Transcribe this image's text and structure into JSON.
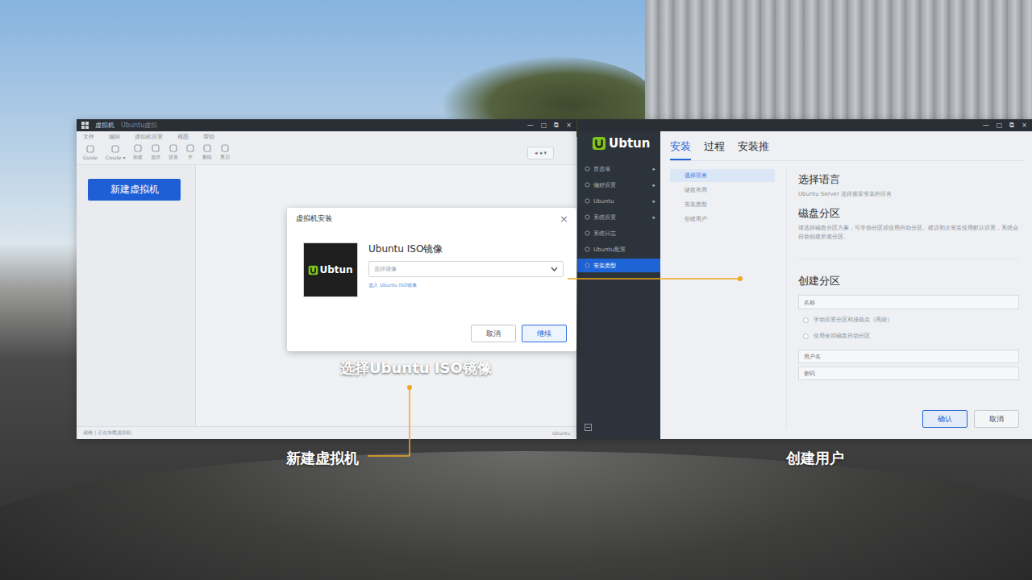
{
  "callouts": [
    {
      "text": "选择Ubuntu ISO镜像"
    },
    {
      "text": "新建虚拟机"
    },
    {
      "text": "创建用户"
    }
  ],
  "vm_window": {
    "title": "虚拟机",
    "subtitle": "Ubuntu虚拟",
    "controls": [
      "—",
      "▢",
      "⧉",
      "×"
    ],
    "menu": [
      "文件",
      "编辑",
      "虚拟机设置",
      "视图",
      "帮助"
    ],
    "toolbar": [
      "Guide",
      "Create ▾",
      "新建",
      "选择",
      "设置",
      "开",
      "删除",
      "重启"
    ],
    "view_select": "◂ ◂ ▾",
    "new_vm_button": "新建虚拟机",
    "status_left": "就绪 | 正在加载虚拟机",
    "status_right": "Ubuntu"
  },
  "dialog": {
    "title": "虚拟机安装",
    "close": "×",
    "logo": "Ubtun",
    "label": "Ubuntu ISO镜像",
    "select_placeholder": "选择镜像",
    "hint": "选入 Ubuntu ISO镜像",
    "buttons": [
      {
        "label": "取消",
        "primary": false
      },
      {
        "label": "继续",
        "primary": true
      }
    ]
  },
  "installer": {
    "logo": "Ubtun",
    "controls": [
      "—",
      "▢",
      "⧉",
      "×"
    ],
    "sidebar": [
      {
        "label": "首选项",
        "arrow": "▸",
        "selected": false
      },
      {
        "label": "偏好设置",
        "arrow": "▸",
        "selected": false
      },
      {
        "label": "Ubuntu",
        "arrow": "▸",
        "selected": false
      },
      {
        "label": "系统设置",
        "arrow": "▸",
        "selected": false
      },
      {
        "label": "系统日志",
        "arrow": "",
        "selected": false
      },
      {
        "label": "Ubuntu配置",
        "arrow": "",
        "selected": false
      },
      {
        "label": "安装类型",
        "arrow": "",
        "selected": true
      }
    ],
    "tabs": [
      {
        "label": "安装",
        "selected": true
      },
      {
        "label": "过程",
        "selected": false
      },
      {
        "label": "安装推",
        "selected": false
      }
    ],
    "steps": [
      {
        "label": "选择语言",
        "selected": true
      },
      {
        "label": "键盘布局",
        "selected": false
      },
      {
        "label": "安装类型",
        "selected": false
      },
      {
        "label": "创建用户",
        "selected": false
      }
    ],
    "language_title": "选择语言",
    "language_text": "Ubuntu Server 选择需要安装的语言",
    "disk_title": "磁盘分区",
    "disk_text": "请选择磁盘分区方案，可手动分区或使用自动分区。建议初次安装使用默认设置，系统会自动创建所需分区。",
    "partition_title": "创建分区",
    "partition_placeholder": "名称",
    "options": [
      {
        "label": "手动设置分区和挂载点（高级）",
        "selected": false
      },
      {
        "label": "使用全部磁盘自动分区",
        "selected": false
      }
    ],
    "fields": [
      "用户名",
      "密码"
    ],
    "buttons": [
      {
        "label": "确认",
        "primary": true
      },
      {
        "label": "取消",
        "primary": false
      }
    ]
  }
}
